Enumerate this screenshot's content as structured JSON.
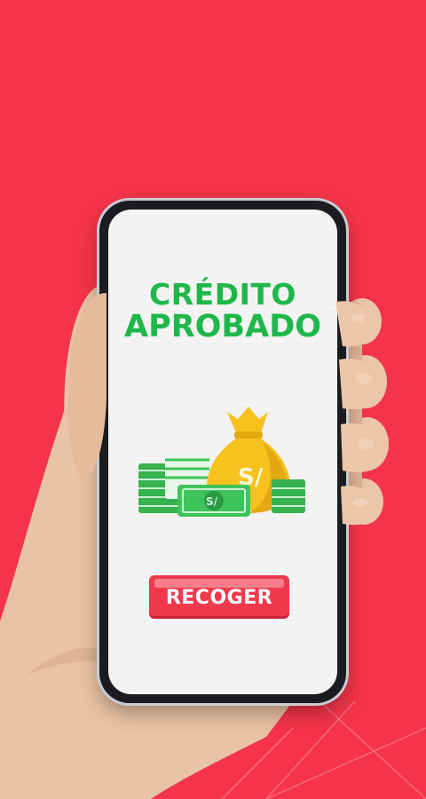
{
  "screen": {
    "title_line1": "CRÉDITO",
    "title_line2": "APROBADO",
    "currency_symbol": "S/",
    "cta_label": "RECOGER"
  },
  "colors": {
    "background": "#f5344a",
    "title_green": "#1fb74a",
    "button_red": "#f0394c",
    "money_green": "#3ec45a",
    "bag_yellow": "#f7c21e"
  },
  "icons": [
    "money-bag-icon",
    "banknote-stack-icon"
  ]
}
